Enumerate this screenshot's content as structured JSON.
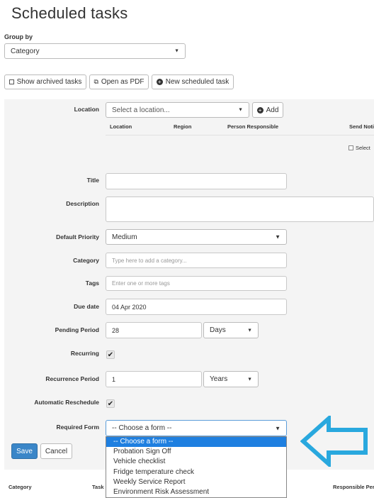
{
  "page": {
    "title": "Scheduled tasks"
  },
  "group_by": {
    "label": "Group by",
    "value": "Category"
  },
  "toolbar": {
    "show_archived": "Show archived tasks",
    "open_pdf": "Open as PDF",
    "new_task": "New scheduled task"
  },
  "location": {
    "label": "Location",
    "placeholder": "Select a location...",
    "add_label": "Add",
    "columns": [
      "Location",
      "Region",
      "Person Responsible",
      "Send Noti"
    ],
    "select_label": "Select"
  },
  "form": {
    "title_label": "Title",
    "description_label": "Description",
    "priority_label": "Default Priority",
    "priority_value": "Medium",
    "category_label": "Category",
    "category_placeholder": "Type here to add a category...",
    "tags_label": "Tags",
    "tags_placeholder": "Enter one or more tags",
    "due_label": "Due date",
    "due_value": "04 Apr 2020",
    "pending_label": "Pending Period",
    "pending_value": "28",
    "pending_unit": "Days",
    "recurring_label": "Recurring",
    "recurrence_label": "Recurrence Period",
    "recurrence_value": "1",
    "recurrence_unit": "Years",
    "auto_label": "Automatic Reschedule",
    "required_form_label": "Required Form",
    "required_form_value": "-- Choose a form --"
  },
  "dropdown": {
    "options": [
      "-- Choose a form --",
      "Probation Sign Off",
      "Vehicle checklist",
      "Fridge temperature check",
      "Weekly Service Report",
      "Environment Risk Assessment"
    ]
  },
  "actions": {
    "save": "Save",
    "cancel": "Cancel"
  },
  "table": {
    "columns": [
      "Category",
      "Task",
      "Responsible Per"
    ]
  },
  "colors": {
    "primary": "#3a86c8",
    "selected": "#1e7fe0",
    "arrow": "#29a8de"
  }
}
